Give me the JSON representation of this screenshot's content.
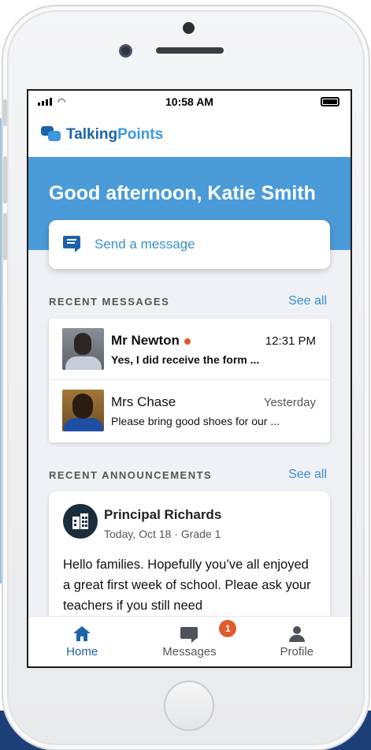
{
  "status_bar": {
    "time": "10:58 AM"
  },
  "app": {
    "logo_part1": "Talking",
    "logo_part2": "Points"
  },
  "hero": {
    "greeting": "Good afternoon, Katie Smith"
  },
  "send_message": {
    "label": "Send a message",
    "icon": "message-icon"
  },
  "recent_messages": {
    "title": "RECENT MESSAGES",
    "see_all": "See all",
    "items": [
      {
        "name": "Mr Newton",
        "time": "12:31 PM",
        "preview": "Yes, I did receive the form ...",
        "unread": true
      },
      {
        "name": "Mrs Chase",
        "time": "Yesterday",
        "preview": "Please bring good shoes for our ...",
        "unread": false
      }
    ]
  },
  "recent_announcements": {
    "title": "RECENT ANNOUNCEMENTS",
    "see_all": "See all",
    "items": [
      {
        "author": "Principal Richards",
        "meta": "Today, Oct 18 · Grade 1",
        "body": "Hello families. Hopefully you’ve all enjoyed a great first week of school. Pleae ask your teachers if you still need",
        "icon": "building-icon"
      }
    ]
  },
  "tab_bar": {
    "tabs": [
      {
        "label": "Home",
        "icon": "home-icon",
        "active": true
      },
      {
        "label": "Messages",
        "icon": "messages-icon",
        "badge": "1"
      },
      {
        "label": "Profile",
        "icon": "profile-icon"
      }
    ]
  },
  "colors": {
    "brand_dark": "#1c63a8",
    "brand_light": "#4a9bd8",
    "unread_accent": "#e05a2b"
  }
}
